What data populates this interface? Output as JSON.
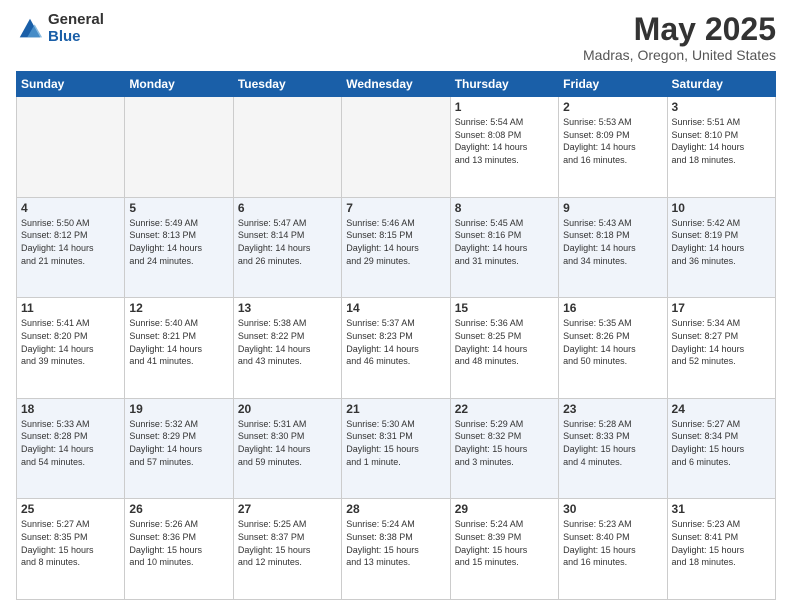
{
  "logo": {
    "general": "General",
    "blue": "Blue"
  },
  "header": {
    "title": "May 2025",
    "subtitle": "Madras, Oregon, United States"
  },
  "days_of_week": [
    "Sunday",
    "Monday",
    "Tuesday",
    "Wednesday",
    "Thursday",
    "Friday",
    "Saturday"
  ],
  "weeks": [
    [
      {
        "day": "",
        "info": ""
      },
      {
        "day": "",
        "info": ""
      },
      {
        "day": "",
        "info": ""
      },
      {
        "day": "",
        "info": ""
      },
      {
        "day": "1",
        "info": "Sunrise: 5:54 AM\nSunset: 8:08 PM\nDaylight: 14 hours\nand 13 minutes."
      },
      {
        "day": "2",
        "info": "Sunrise: 5:53 AM\nSunset: 8:09 PM\nDaylight: 14 hours\nand 16 minutes."
      },
      {
        "day": "3",
        "info": "Sunrise: 5:51 AM\nSunset: 8:10 PM\nDaylight: 14 hours\nand 18 minutes."
      }
    ],
    [
      {
        "day": "4",
        "info": "Sunrise: 5:50 AM\nSunset: 8:12 PM\nDaylight: 14 hours\nand 21 minutes."
      },
      {
        "day": "5",
        "info": "Sunrise: 5:49 AM\nSunset: 8:13 PM\nDaylight: 14 hours\nand 24 minutes."
      },
      {
        "day": "6",
        "info": "Sunrise: 5:47 AM\nSunset: 8:14 PM\nDaylight: 14 hours\nand 26 minutes."
      },
      {
        "day": "7",
        "info": "Sunrise: 5:46 AM\nSunset: 8:15 PM\nDaylight: 14 hours\nand 29 minutes."
      },
      {
        "day": "8",
        "info": "Sunrise: 5:45 AM\nSunset: 8:16 PM\nDaylight: 14 hours\nand 31 minutes."
      },
      {
        "day": "9",
        "info": "Sunrise: 5:43 AM\nSunset: 8:18 PM\nDaylight: 14 hours\nand 34 minutes."
      },
      {
        "day": "10",
        "info": "Sunrise: 5:42 AM\nSunset: 8:19 PM\nDaylight: 14 hours\nand 36 minutes."
      }
    ],
    [
      {
        "day": "11",
        "info": "Sunrise: 5:41 AM\nSunset: 8:20 PM\nDaylight: 14 hours\nand 39 minutes."
      },
      {
        "day": "12",
        "info": "Sunrise: 5:40 AM\nSunset: 8:21 PM\nDaylight: 14 hours\nand 41 minutes."
      },
      {
        "day": "13",
        "info": "Sunrise: 5:38 AM\nSunset: 8:22 PM\nDaylight: 14 hours\nand 43 minutes."
      },
      {
        "day": "14",
        "info": "Sunrise: 5:37 AM\nSunset: 8:23 PM\nDaylight: 14 hours\nand 46 minutes."
      },
      {
        "day": "15",
        "info": "Sunrise: 5:36 AM\nSunset: 8:25 PM\nDaylight: 14 hours\nand 48 minutes."
      },
      {
        "day": "16",
        "info": "Sunrise: 5:35 AM\nSunset: 8:26 PM\nDaylight: 14 hours\nand 50 minutes."
      },
      {
        "day": "17",
        "info": "Sunrise: 5:34 AM\nSunset: 8:27 PM\nDaylight: 14 hours\nand 52 minutes."
      }
    ],
    [
      {
        "day": "18",
        "info": "Sunrise: 5:33 AM\nSunset: 8:28 PM\nDaylight: 14 hours\nand 54 minutes."
      },
      {
        "day": "19",
        "info": "Sunrise: 5:32 AM\nSunset: 8:29 PM\nDaylight: 14 hours\nand 57 minutes."
      },
      {
        "day": "20",
        "info": "Sunrise: 5:31 AM\nSunset: 8:30 PM\nDaylight: 14 hours\nand 59 minutes."
      },
      {
        "day": "21",
        "info": "Sunrise: 5:30 AM\nSunset: 8:31 PM\nDaylight: 15 hours\nand 1 minute."
      },
      {
        "day": "22",
        "info": "Sunrise: 5:29 AM\nSunset: 8:32 PM\nDaylight: 15 hours\nand 3 minutes."
      },
      {
        "day": "23",
        "info": "Sunrise: 5:28 AM\nSunset: 8:33 PM\nDaylight: 15 hours\nand 4 minutes."
      },
      {
        "day": "24",
        "info": "Sunrise: 5:27 AM\nSunset: 8:34 PM\nDaylight: 15 hours\nand 6 minutes."
      }
    ],
    [
      {
        "day": "25",
        "info": "Sunrise: 5:27 AM\nSunset: 8:35 PM\nDaylight: 15 hours\nand 8 minutes."
      },
      {
        "day": "26",
        "info": "Sunrise: 5:26 AM\nSunset: 8:36 PM\nDaylight: 15 hours\nand 10 minutes."
      },
      {
        "day": "27",
        "info": "Sunrise: 5:25 AM\nSunset: 8:37 PM\nDaylight: 15 hours\nand 12 minutes."
      },
      {
        "day": "28",
        "info": "Sunrise: 5:24 AM\nSunset: 8:38 PM\nDaylight: 15 hours\nand 13 minutes."
      },
      {
        "day": "29",
        "info": "Sunrise: 5:24 AM\nSunset: 8:39 PM\nDaylight: 15 hours\nand 15 minutes."
      },
      {
        "day": "30",
        "info": "Sunrise: 5:23 AM\nSunset: 8:40 PM\nDaylight: 15 hours\nand 16 minutes."
      },
      {
        "day": "31",
        "info": "Sunrise: 5:23 AM\nSunset: 8:41 PM\nDaylight: 15 hours\nand 18 minutes."
      }
    ]
  ]
}
